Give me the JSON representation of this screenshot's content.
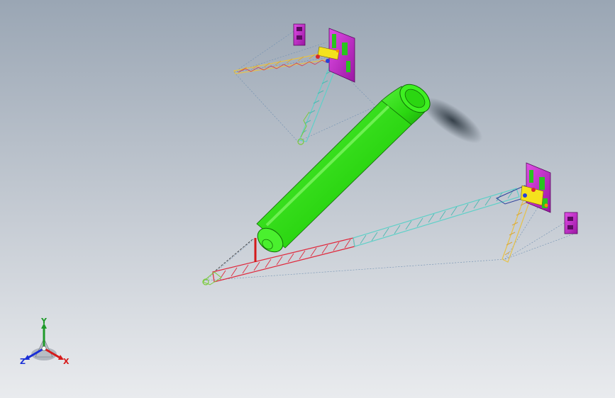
{
  "window": {
    "title": ""
  },
  "view_triad": {
    "x_label": "X",
    "y_label": "Y",
    "z_label": "Z"
  },
  "colors": {
    "background_top": "#9aa6b4",
    "background_bottom": "#e9ebee",
    "cylinder": "#33e01a",
    "bracket": "#d52bd8",
    "lattice_red": "#e0283c",
    "lattice_cyan": "#5fd0c8",
    "lattice_yellow": "#e6c24a",
    "axis_x": "#d61a1a",
    "axis_y": "#1f9a2a",
    "axis_z": "#1a2fd6"
  },
  "model": {
    "components": [
      {
        "name": "green-cylinder-icon"
      },
      {
        "name": "upper-crane-assembly-icon"
      },
      {
        "name": "lower-crane-assembly-icon"
      }
    ]
  }
}
